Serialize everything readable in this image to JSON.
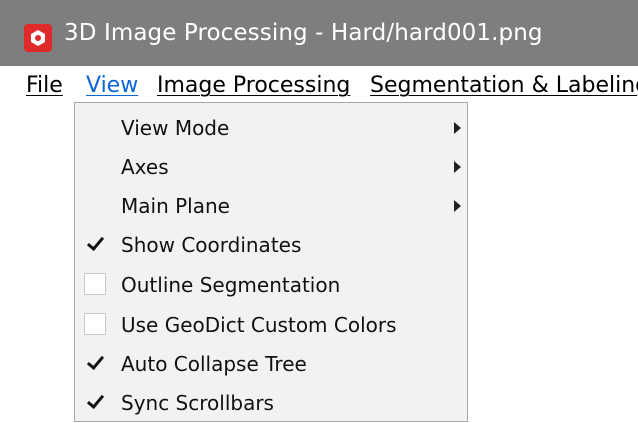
{
  "window": {
    "title": "3D Image Processing - Hard/hard001.png",
    "icon": "app-hex-icon",
    "icon_color": "#e02a2a",
    "titlebar_color": "#7e7e7e"
  },
  "menubar": {
    "items": [
      {
        "label": "File",
        "active": false
      },
      {
        "label": "View",
        "active": true
      },
      {
        "label": "Image Processing",
        "active": false
      },
      {
        "label": "Segmentation & Labeling",
        "active": false
      }
    ],
    "active_color": "#0a66d8"
  },
  "view_menu": {
    "items": [
      {
        "label": "View Mode",
        "type": "submenu"
      },
      {
        "label": "Axes",
        "type": "submenu"
      },
      {
        "label": "Main Plane",
        "type": "submenu"
      },
      {
        "label": "Show Coordinates",
        "type": "check",
        "checked": true
      },
      {
        "label": "Outline Segmentation",
        "type": "check",
        "checked": false
      },
      {
        "label": "Use GeoDict Custom Colors",
        "type": "check",
        "checked": false
      },
      {
        "label": "Auto Collapse Tree",
        "type": "check",
        "checked": true
      },
      {
        "label": "Sync Scrollbars",
        "type": "check",
        "checked": true
      }
    ]
  }
}
